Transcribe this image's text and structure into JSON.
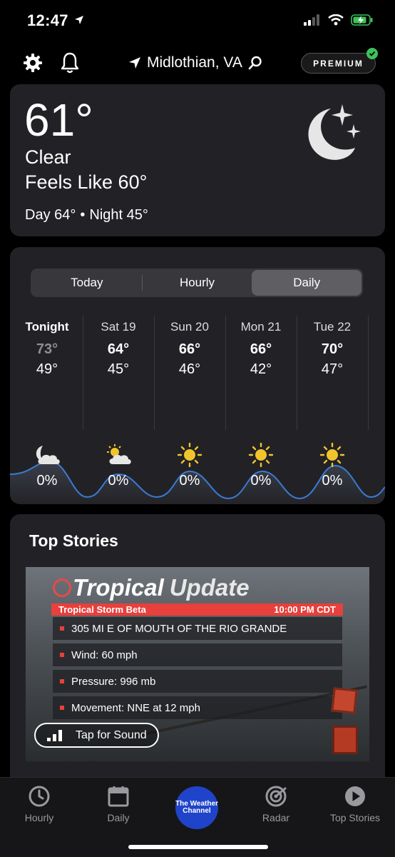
{
  "status": {
    "time": "12:47"
  },
  "header": {
    "location": "Midlothian, VA",
    "premium": "PREMIUM"
  },
  "current": {
    "temp": "61°",
    "condition": "Clear",
    "feels_like": "Feels Like 60°",
    "day": "Day 64°",
    "separator": "•",
    "night": "Night 45°"
  },
  "forecast": {
    "tabs": [
      {
        "label": "Today"
      },
      {
        "label": "Hourly"
      },
      {
        "label": "Daily",
        "active": true
      }
    ],
    "days": [
      {
        "label": "Tonight",
        "hi": "73°",
        "lo": "49°",
        "icon": "partly-cloudy-night-icon",
        "precip": "0%"
      },
      {
        "label": "Sat 19",
        "hi": "64°",
        "lo": "45°",
        "icon": "partly-cloudy-icon",
        "precip": "0%"
      },
      {
        "label": "Sun 20",
        "hi": "66°",
        "lo": "46°",
        "icon": "sun-icon",
        "precip": "0%"
      },
      {
        "label": "Mon 21",
        "hi": "66°",
        "lo": "42°",
        "icon": "sun-icon",
        "precip": "0%"
      },
      {
        "label": "Tue 22",
        "hi": "70°",
        "lo": "47°",
        "icon": "sun-icon",
        "precip": "0%"
      }
    ]
  },
  "stories": {
    "title": "Top Stories",
    "video": {
      "headline_a": "Tropical",
      "headline_b": "Update",
      "storm": "Tropical Storm Beta",
      "time": "10:00 PM CDT",
      "lines": [
        "305 MI E OF MOUTH OF THE RIO GRANDE",
        "Wind:  60 mph",
        "Pressure:  996 mb",
        "Movement: NNE at 12 mph"
      ],
      "tap_label": "Tap for Sound"
    }
  },
  "nav": {
    "items": [
      {
        "label": "Hourly"
      },
      {
        "label": "Daily"
      },
      {
        "label": "The Weather Channel"
      },
      {
        "label": "Radar"
      },
      {
        "label": "Top Stories"
      }
    ]
  },
  "colors": {
    "card": "#222226",
    "accent": "#1f44c9",
    "curve": "#3a7bd5",
    "alert": "#e8403c"
  }
}
